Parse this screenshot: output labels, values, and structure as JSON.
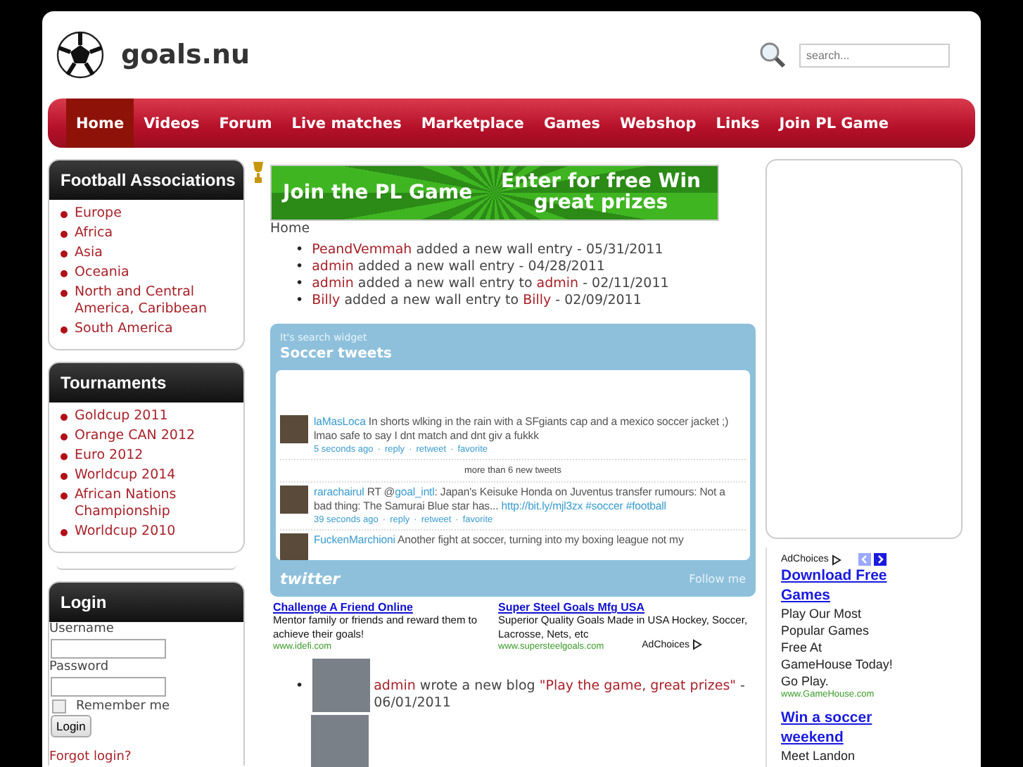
{
  "site": {
    "title": "goals.nu"
  },
  "search": {
    "placeholder": "search..."
  },
  "nav": [
    {
      "label": "Home",
      "selected": true
    },
    {
      "label": "Videos",
      "selected": false
    },
    {
      "label": "Forum",
      "selected": false
    },
    {
      "label": "Live matches",
      "selected": false
    },
    {
      "label": "Marketplace",
      "selected": false
    },
    {
      "label": "Games",
      "selected": false
    },
    {
      "label": "Webshop",
      "selected": false
    },
    {
      "label": "Links",
      "selected": false
    },
    {
      "label": "Join PL Game",
      "selected": false
    }
  ],
  "sidebar": [
    {
      "title": "Football Associations",
      "items": [
        "Europe",
        "Africa",
        "Asia",
        "Oceania",
        "North and Central America, Caribbean",
        "South America"
      ]
    },
    {
      "title": "Tournaments",
      "items": [
        "Goldcup 2011",
        "Orange CAN 2012",
        "Euro 2012",
        "Worldcup 2014",
        "African Nations Championship",
        "Worldcup 2010"
      ]
    }
  ],
  "login": {
    "title": "Login",
    "fields": [
      "Username",
      "Password"
    ],
    "remember": {
      "label": "Remember me",
      "checked": false
    },
    "button": "Login",
    "forgot": "Forgot login?"
  },
  "banner": {
    "left": "Join the PL Game",
    "right": "Enter for free Win great prizes"
  },
  "breadcrumb": "Home",
  "list_marker": "•",
  "activity": [
    {
      "actor": "PeandVemmah",
      "action": "added a new wall entry",
      "date": "- 05/31/2011"
    },
    {
      "actor": "admin",
      "action": "added a new wall entry",
      "date": "- 04/28/2011"
    },
    {
      "actor": "admin",
      "action": "added a new wall entry to",
      "target": "admin",
      "date": "- 02/11/2011"
    },
    {
      "actor": "Billy",
      "action": "added a new wall entry to",
      "target": "Billy",
      "date": "- 02/09/2011"
    }
  ],
  "tweets_widget": {
    "subtitle": "It's search widget",
    "title": "Soccer tweets",
    "logo": "twitter",
    "follow": "Follow me",
    "tweets": [
      {
        "user": "laMasLoca",
        "text": [
          {
            "t": "In shorts wlking in the rain with a SFgiants cap and a mexico soccer jacket ;) lmao safe to say I dnt match and dnt giv a fukkk",
            "link": false
          }
        ],
        "meta": [
          "5 seconds ago",
          "·",
          "reply",
          "·",
          "retweet",
          "·",
          "favorite"
        ],
        "separator": "more than 6 new tweets"
      },
      {
        "user": "rarachairul",
        "text": [
          {
            "t": "RT @",
            "link": false,
            "joined": false
          },
          {
            "t": "goal_intl",
            "link": true,
            "joined": true
          },
          {
            "t": ": Japan's Keisuke Honda on Juventus transfer rumours: Not a bad thing: The Samurai Blue star has...",
            "link": false,
            "joined": true
          },
          {
            "t": "http://bit.ly/mjl3zx",
            "link": true,
            "joined": false
          },
          {
            "t": "#soccer",
            "link": true,
            "joined": false
          },
          {
            "t": "#football",
            "link": true,
            "joined": false
          }
        ],
        "meta": [
          "39 seconds ago",
          "·",
          "reply",
          "·",
          "retweet",
          "·",
          "favorite"
        ]
      },
      {
        "user": "FuckenMarchioni",
        "text": [
          {
            "t": "Another fight at soccer, turning into my boxing league not my",
            "link": false
          }
        ]
      }
    ]
  },
  "ads": [
    {
      "title": "Challenge A Friend Online",
      "desc": "Mentor family or friends and reward them to achieve their goals!",
      "url": "www.idefi.com"
    },
    {
      "title": "Super Steel Goals Mfg USA",
      "desc": "Superior Quality Goals Made in USA Hockey, Soccer, Lacrosse, Nets, etc",
      "url": "www.supersteelgoals.com"
    }
  ],
  "ad_choices": "AdChoices",
  "blog": [
    {
      "author": "admin",
      "action": "wrote a new blog",
      "title": "\"Play the game, great prizes\"",
      "date": "- 06/01/2011"
    }
  ],
  "side_ads": {
    "label": "AdChoices",
    "items": [
      {
        "title": "Download Free Games",
        "desc": "Play Our Most Popular Games Free At GameHouse Today! Go Play.",
        "url": "www.GameHouse.com"
      },
      {
        "title": "Win a soccer weekend",
        "desc": "Meet Landon"
      }
    ]
  }
}
